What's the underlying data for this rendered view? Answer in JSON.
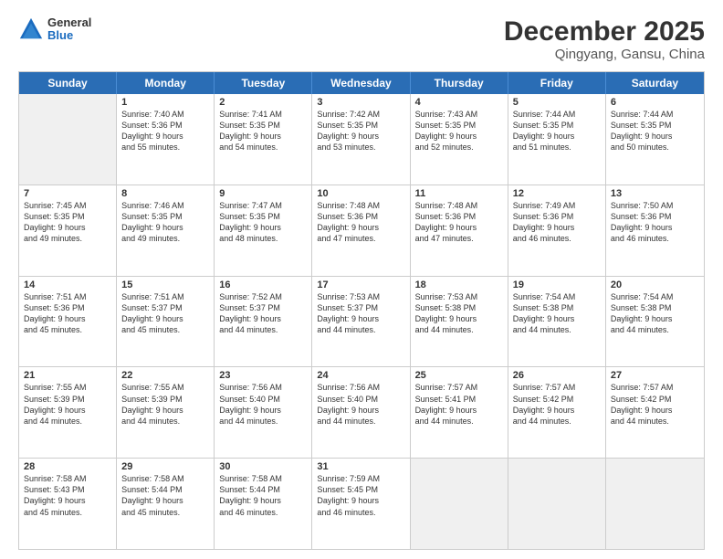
{
  "header": {
    "logo_general": "General",
    "logo_blue": "Blue",
    "title": "December 2025",
    "subtitle": "Qingyang, Gansu, China"
  },
  "weekdays": [
    "Sunday",
    "Monday",
    "Tuesday",
    "Wednesday",
    "Thursday",
    "Friday",
    "Saturday"
  ],
  "rows": [
    [
      {
        "day": "",
        "lines": []
      },
      {
        "day": "1",
        "lines": [
          "Sunrise: 7:40 AM",
          "Sunset: 5:36 PM",
          "Daylight: 9 hours",
          "and 55 minutes."
        ]
      },
      {
        "day": "2",
        "lines": [
          "Sunrise: 7:41 AM",
          "Sunset: 5:35 PM",
          "Daylight: 9 hours",
          "and 54 minutes."
        ]
      },
      {
        "day": "3",
        "lines": [
          "Sunrise: 7:42 AM",
          "Sunset: 5:35 PM",
          "Daylight: 9 hours",
          "and 53 minutes."
        ]
      },
      {
        "day": "4",
        "lines": [
          "Sunrise: 7:43 AM",
          "Sunset: 5:35 PM",
          "Daylight: 9 hours",
          "and 52 minutes."
        ]
      },
      {
        "day": "5",
        "lines": [
          "Sunrise: 7:44 AM",
          "Sunset: 5:35 PM",
          "Daylight: 9 hours",
          "and 51 minutes."
        ]
      },
      {
        "day": "6",
        "lines": [
          "Sunrise: 7:44 AM",
          "Sunset: 5:35 PM",
          "Daylight: 9 hours",
          "and 50 minutes."
        ]
      }
    ],
    [
      {
        "day": "7",
        "lines": [
          "Sunrise: 7:45 AM",
          "Sunset: 5:35 PM",
          "Daylight: 9 hours",
          "and 49 minutes."
        ]
      },
      {
        "day": "8",
        "lines": [
          "Sunrise: 7:46 AM",
          "Sunset: 5:35 PM",
          "Daylight: 9 hours",
          "and 49 minutes."
        ]
      },
      {
        "day": "9",
        "lines": [
          "Sunrise: 7:47 AM",
          "Sunset: 5:35 PM",
          "Daylight: 9 hours",
          "and 48 minutes."
        ]
      },
      {
        "day": "10",
        "lines": [
          "Sunrise: 7:48 AM",
          "Sunset: 5:36 PM",
          "Daylight: 9 hours",
          "and 47 minutes."
        ]
      },
      {
        "day": "11",
        "lines": [
          "Sunrise: 7:48 AM",
          "Sunset: 5:36 PM",
          "Daylight: 9 hours",
          "and 47 minutes."
        ]
      },
      {
        "day": "12",
        "lines": [
          "Sunrise: 7:49 AM",
          "Sunset: 5:36 PM",
          "Daylight: 9 hours",
          "and 46 minutes."
        ]
      },
      {
        "day": "13",
        "lines": [
          "Sunrise: 7:50 AM",
          "Sunset: 5:36 PM",
          "Daylight: 9 hours",
          "and 46 minutes."
        ]
      }
    ],
    [
      {
        "day": "14",
        "lines": [
          "Sunrise: 7:51 AM",
          "Sunset: 5:36 PM",
          "Daylight: 9 hours",
          "and 45 minutes."
        ]
      },
      {
        "day": "15",
        "lines": [
          "Sunrise: 7:51 AM",
          "Sunset: 5:37 PM",
          "Daylight: 9 hours",
          "and 45 minutes."
        ]
      },
      {
        "day": "16",
        "lines": [
          "Sunrise: 7:52 AM",
          "Sunset: 5:37 PM",
          "Daylight: 9 hours",
          "and 44 minutes."
        ]
      },
      {
        "day": "17",
        "lines": [
          "Sunrise: 7:53 AM",
          "Sunset: 5:37 PM",
          "Daylight: 9 hours",
          "and 44 minutes."
        ]
      },
      {
        "day": "18",
        "lines": [
          "Sunrise: 7:53 AM",
          "Sunset: 5:38 PM",
          "Daylight: 9 hours",
          "and 44 minutes."
        ]
      },
      {
        "day": "19",
        "lines": [
          "Sunrise: 7:54 AM",
          "Sunset: 5:38 PM",
          "Daylight: 9 hours",
          "and 44 minutes."
        ]
      },
      {
        "day": "20",
        "lines": [
          "Sunrise: 7:54 AM",
          "Sunset: 5:38 PM",
          "Daylight: 9 hours",
          "and 44 minutes."
        ]
      }
    ],
    [
      {
        "day": "21",
        "lines": [
          "Sunrise: 7:55 AM",
          "Sunset: 5:39 PM",
          "Daylight: 9 hours",
          "and 44 minutes."
        ]
      },
      {
        "day": "22",
        "lines": [
          "Sunrise: 7:55 AM",
          "Sunset: 5:39 PM",
          "Daylight: 9 hours",
          "and 44 minutes."
        ]
      },
      {
        "day": "23",
        "lines": [
          "Sunrise: 7:56 AM",
          "Sunset: 5:40 PM",
          "Daylight: 9 hours",
          "and 44 minutes."
        ]
      },
      {
        "day": "24",
        "lines": [
          "Sunrise: 7:56 AM",
          "Sunset: 5:40 PM",
          "Daylight: 9 hours",
          "and 44 minutes."
        ]
      },
      {
        "day": "25",
        "lines": [
          "Sunrise: 7:57 AM",
          "Sunset: 5:41 PM",
          "Daylight: 9 hours",
          "and 44 minutes."
        ]
      },
      {
        "day": "26",
        "lines": [
          "Sunrise: 7:57 AM",
          "Sunset: 5:42 PM",
          "Daylight: 9 hours",
          "and 44 minutes."
        ]
      },
      {
        "day": "27",
        "lines": [
          "Sunrise: 7:57 AM",
          "Sunset: 5:42 PM",
          "Daylight: 9 hours",
          "and 44 minutes."
        ]
      }
    ],
    [
      {
        "day": "28",
        "lines": [
          "Sunrise: 7:58 AM",
          "Sunset: 5:43 PM",
          "Daylight: 9 hours",
          "and 45 minutes."
        ]
      },
      {
        "day": "29",
        "lines": [
          "Sunrise: 7:58 AM",
          "Sunset: 5:44 PM",
          "Daylight: 9 hours",
          "and 45 minutes."
        ]
      },
      {
        "day": "30",
        "lines": [
          "Sunrise: 7:58 AM",
          "Sunset: 5:44 PM",
          "Daylight: 9 hours",
          "and 46 minutes."
        ]
      },
      {
        "day": "31",
        "lines": [
          "Sunrise: 7:59 AM",
          "Sunset: 5:45 PM",
          "Daylight: 9 hours",
          "and 46 minutes."
        ]
      },
      {
        "day": "",
        "lines": []
      },
      {
        "day": "",
        "lines": []
      },
      {
        "day": "",
        "lines": []
      }
    ]
  ]
}
